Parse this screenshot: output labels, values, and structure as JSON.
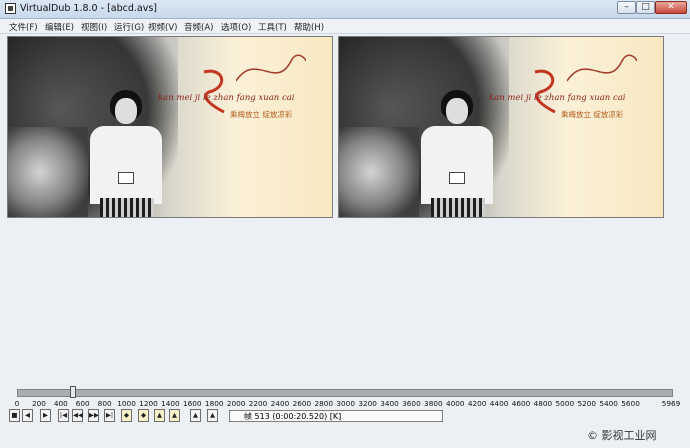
{
  "window": {
    "title": "VirtualDub 1.8.0 - [abcd.avs]",
    "min": "–",
    "max": "□",
    "close": "✕"
  },
  "menu": [
    "文件(F)",
    "编辑(E)",
    "视图(I)",
    "运行(G)",
    "视频(V)",
    "音频(A)",
    "选项(O)",
    "工具(T)",
    "帮助(H)"
  ],
  "video": {
    "script_text": "kan mei ji le zhan fang xuan cai",
    "slogan": "乘梅放立 绽放凉彩"
  },
  "timeline": {
    "ticks": [
      "0",
      "200",
      "400",
      "600",
      "800",
      "1000",
      "1200",
      "1400",
      "1600",
      "1800",
      "2000",
      "2200",
      "2400",
      "2600",
      "2800",
      "3000",
      "3200",
      "3400",
      "3600",
      "3800",
      "4000",
      "4200",
      "4400",
      "4600",
      "4800",
      "5000",
      "5200",
      "5400",
      "5600",
      "5969"
    ],
    "max_frame": 5969,
    "current_frame": 513
  },
  "toolbar": {
    "buttons": [
      "stop",
      "prev-key",
      "next-key",
      "start",
      "back",
      "fwd",
      "end",
      "scene-prev",
      "scene-next",
      "mark-in",
      "mark-out",
      "keyframe",
      "play-input",
      "play-output"
    ],
    "icons": [
      "■",
      "◀",
      "▶",
      "|◀",
      "◀◀",
      "▶▶",
      "▶|",
      "◆",
      "◆",
      "▲",
      "▲",
      "▲",
      "▲",
      "▲"
    ]
  },
  "status": {
    "text": "帧 513 (0:00:20.520) [K]"
  },
  "watermark": "© 影视工业网"
}
